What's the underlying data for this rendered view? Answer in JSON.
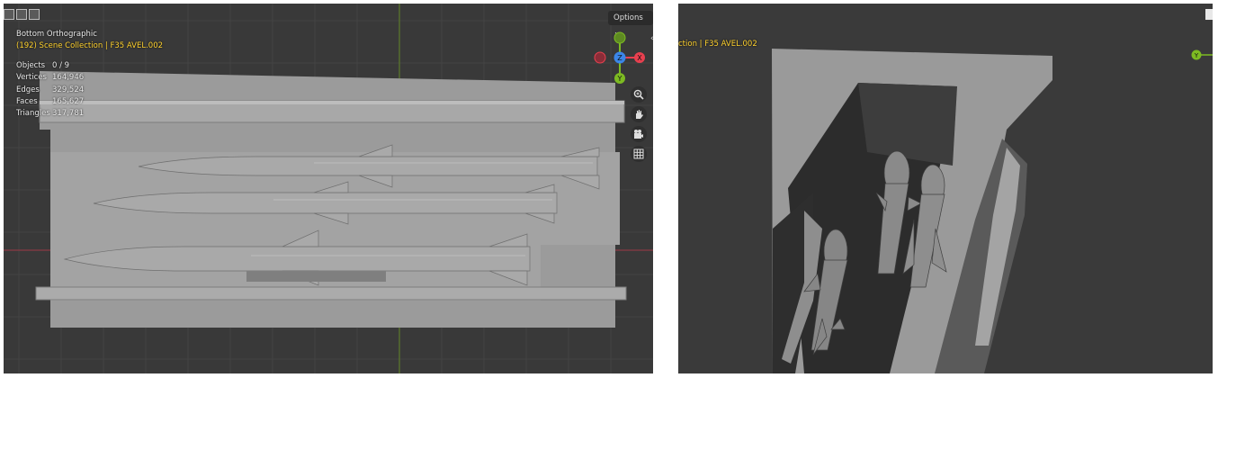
{
  "left_viewport": {
    "view_name": "Bottom Orthographic",
    "collection": "(192) Scene Collection | F35 AVEL.002",
    "options_label": "Options",
    "stats": [
      {
        "label": "Objects",
        "value": "0 / 9"
      },
      {
        "label": "Vertices",
        "value": "164,946"
      },
      {
        "label": "Edges",
        "value": "329,524"
      },
      {
        "label": "Faces",
        "value": "165,627"
      },
      {
        "label": "Triangles",
        "value": "317,781"
      }
    ],
    "gizmo": {
      "top": "",
      "center": "Z",
      "right": "X",
      "bottom": "Y"
    },
    "axis_colors": {
      "x": "#e8404f",
      "y": "#7dbb22",
      "z": "#3b86e8"
    }
  },
  "right_viewport": {
    "collection_partial": "ction | F35 AVEL.002",
    "axis_label": "Y"
  },
  "icons": [
    "zoom-in-icon",
    "hand-pan-icon",
    "camera-icon",
    "grid-icon",
    "chevron-down-icon"
  ]
}
